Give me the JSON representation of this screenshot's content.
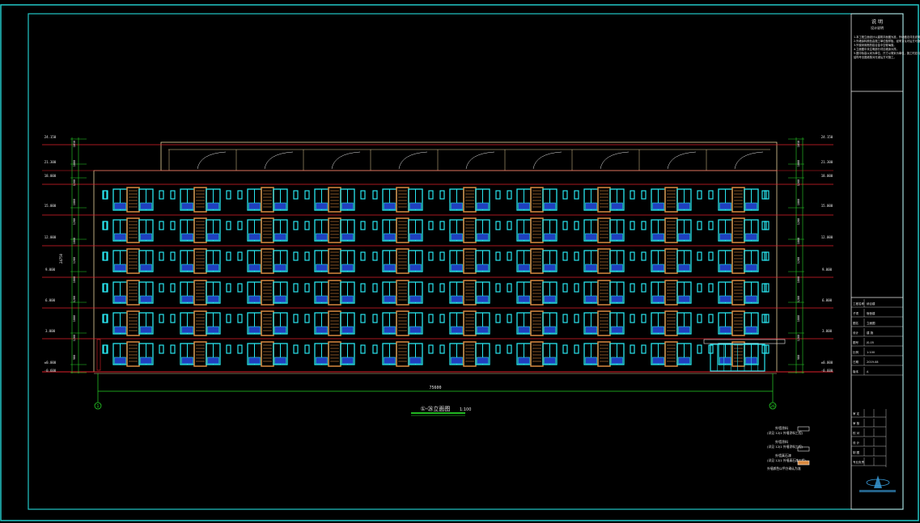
{
  "colors": {
    "background": "#000000",
    "frame": "#22c7c7",
    "floor_line": "#e0202a",
    "wall": "#e7d29a",
    "window": "#28e6f0",
    "glass": "#1f3fbf",
    "panel": "#d9893f",
    "dim": "#27d327",
    "text": "#e8e8e8"
  },
  "drawing": {
    "total_dim": "75600",
    "axis_left": "1",
    "axis_right": "26",
    "title": "①-㉖立面图",
    "scale": "1:100",
    "left_elevations": [
      "24.150",
      "21.300",
      "18.000",
      "15.000",
      "12.000",
      "9.000",
      "6.000",
      "3.000",
      "±0.000",
      "-0.600"
    ],
    "right_elevations": [
      "24.150",
      "21.300",
      "18.000",
      "15.000",
      "12.000",
      "9.000",
      "6.000",
      "3.000",
      "±0.000",
      "-0.600"
    ],
    "dim_segments": [
      "1050",
      "1800",
      "1200",
      "1800",
      "1200",
      "1800",
      "1200",
      "1800",
      "1200",
      "1800",
      "1200",
      "900"
    ],
    "side_dim": "24750"
  },
  "legend": {
    "items": [
      {
        "label": "外墙涂料",
        "code": "(详见 12J1 外墙涂料工程)"
      },
      {
        "label": "外墙涂料",
        "code": "(详见 12J1 外墙涂料工程)"
      },
      {
        "label": "外墙真石漆",
        "code": "(详见 12J1 外墙真石漆工程)"
      }
    ],
    "note": "外墙颜色以甲方确认为准"
  },
  "title_block": {
    "header": "说 明",
    "subheader": "设计说明",
    "notes": [
      "1.本工程立面设计以建筑平面图为准，外墙做法详见说明。",
      "2.外墙涂料颜色由施工单位做样板，经甲方认可后方可施工。",
      "3.外窗采用断热铝合金中空玻璃窗。",
      "4.立面图中未注明部分详见墙身大样。",
      "5.图中标高以米为单位，尺寸以毫米为单位，施工时应与",
      "   结构专业图纸核对无误后方可施工。"
    ],
    "rows": [
      {
        "k": "工程名称",
        "v": "综合楼"
      },
      {
        "k": "子项",
        "v": "宿舍楼"
      },
      {
        "k": "图名",
        "v": "立面图"
      },
      {
        "k": "设计",
        "v": "建 施"
      },
      {
        "k": "图号",
        "v": "JS-05"
      },
      {
        "k": "比例",
        "v": "1:100"
      },
      {
        "k": "日期",
        "v": "2019.08"
      },
      {
        "k": "版本",
        "v": "A"
      }
    ],
    "sign_rows": [
      "审 定",
      "审 核",
      "校 对",
      "设 计",
      "制 图",
      "专业负责"
    ]
  }
}
